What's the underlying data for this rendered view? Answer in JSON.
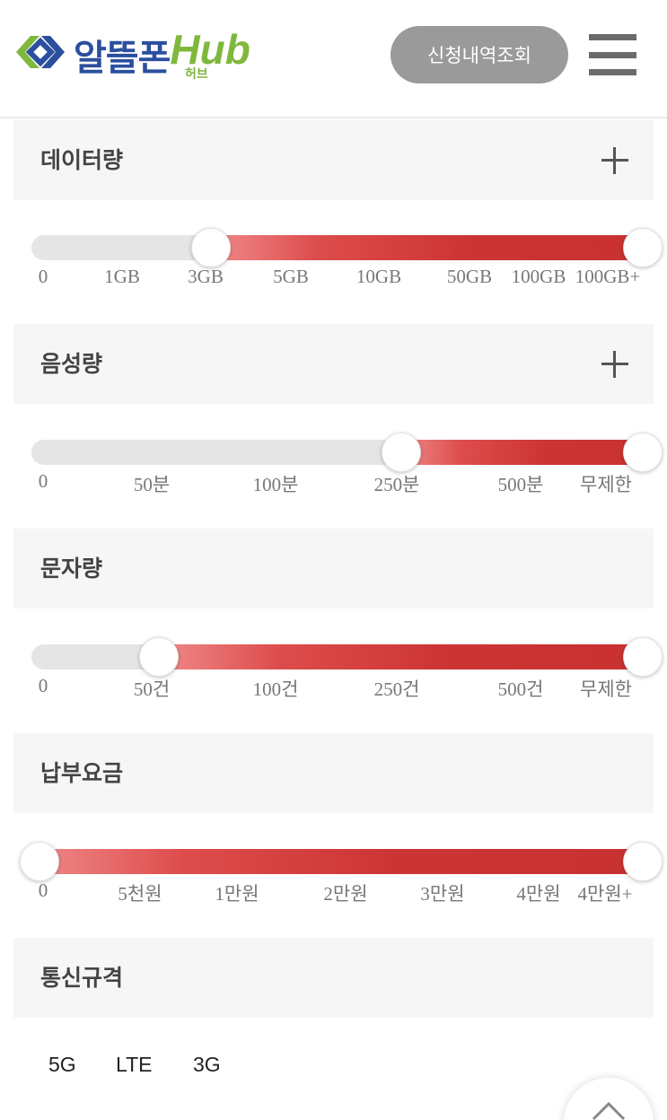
{
  "header": {
    "logo_text": "알뜰폰",
    "logo_hub": "Hub",
    "logo_sub": "허브",
    "history_button": "신청내역조회",
    "menu_icon": "hamburger-menu-icon"
  },
  "filters": [
    {
      "title": "데이터량",
      "expandable": true,
      "ticks": [
        "0",
        "1GB",
        "3GB",
        "5GB",
        "10GB",
        "50GB",
        "100GB",
        "100GB+"
      ],
      "range": [
        "3GB",
        "100GB+"
      ]
    },
    {
      "title": "음성량",
      "expandable": true,
      "ticks": [
        "0",
        "50분",
        "100분",
        "250분",
        "500분",
        "무제한"
      ],
      "range": [
        "250분",
        "무제한"
      ]
    },
    {
      "title": "문자량",
      "expandable": false,
      "ticks": [
        "0",
        "50건",
        "100건",
        "250건",
        "500건",
        "무제한"
      ],
      "range": [
        "50건",
        "무제한"
      ]
    },
    {
      "title": "납부요금",
      "expandable": false,
      "ticks": [
        "0",
        "5천원",
        "1만원",
        "2만원",
        "3만원",
        "4만원",
        "4만원+"
      ],
      "range": [
        "0",
        "4만원+"
      ]
    },
    {
      "title": "통신규격",
      "expandable": false
    }
  ],
  "network_options": [
    "5G",
    "LTE",
    "3G"
  ],
  "colors": {
    "accent": "#cc3434",
    "track": "#e5e5e5",
    "section_bg": "#f6f6f6",
    "logo_blue": "#2b4f9e",
    "logo_green": "#7fb83d"
  },
  "scroll_top_icon": "chevron-up-icon"
}
